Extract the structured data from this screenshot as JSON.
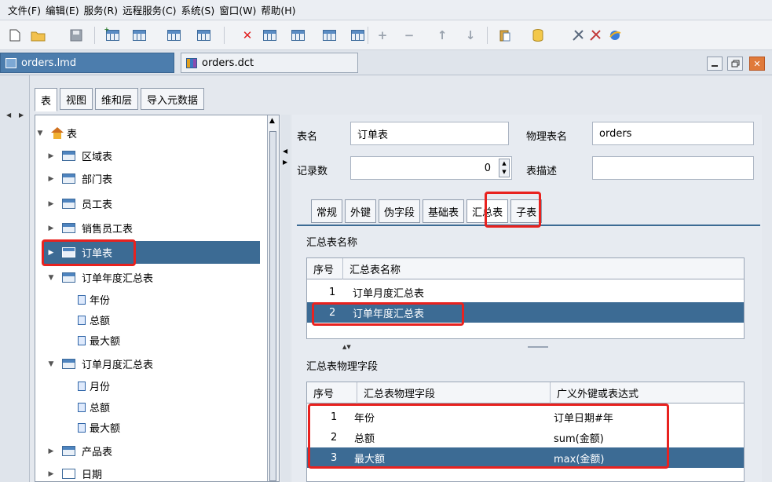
{
  "menu": [
    "文件(F)",
    "编辑(E)",
    "服务(R)",
    "远程服务(C)",
    "系统(S)",
    "窗口(W)",
    "帮助(H)"
  ],
  "documents": {
    "active": "orders.lmd",
    "inactive": "orders.dct"
  },
  "tree_tabs": [
    "表",
    "视图",
    "维和层",
    "导入元数据"
  ],
  "tree": {
    "root": "表",
    "items": [
      {
        "label": "区域表",
        "type": "table",
        "expanded": false
      },
      {
        "label": "部门表",
        "type": "table",
        "expanded": false
      },
      {
        "label": "员工表",
        "type": "table",
        "expanded": false
      },
      {
        "label": "销售员工表",
        "type": "table",
        "expanded": false
      },
      {
        "label": "订单表",
        "type": "table",
        "expanded": false,
        "selected": true
      },
      {
        "label": "订单年度汇总表",
        "type": "table",
        "expanded": true
      },
      {
        "label": "年份",
        "type": "field"
      },
      {
        "label": "总额",
        "type": "field"
      },
      {
        "label": "最大额",
        "type": "field"
      },
      {
        "label": "订单月度汇总表",
        "type": "table",
        "expanded": true
      },
      {
        "label": "月份",
        "type": "field"
      },
      {
        "label": "总额",
        "type": "field"
      },
      {
        "label": "最大额",
        "type": "field"
      },
      {
        "label": "产品表",
        "type": "table",
        "expanded": false
      },
      {
        "label": "日期",
        "type": "table",
        "expanded": false
      }
    ]
  },
  "form": {
    "table_name_label": "表名",
    "table_name_value": "订单表",
    "physical_name_label": "物理表名",
    "physical_name_value": "orders",
    "record_count_label": "记录数",
    "record_count_value": "0",
    "description_label": "表描述",
    "description_value": ""
  },
  "detail_tabs": [
    "常规",
    "外键",
    "伪字段",
    "基础表",
    "汇总表",
    "子表"
  ],
  "detail_active_tab": "汇总表",
  "summary_tables": {
    "title": "汇总表名称",
    "columns": [
      "序号",
      "汇总表名称"
    ],
    "rows": [
      {
        "no": "1",
        "name": "订单月度汇总表",
        "selected": false
      },
      {
        "no": "2",
        "name": "订单年度汇总表",
        "selected": true
      }
    ]
  },
  "summary_fields": {
    "title": "汇总表物理字段",
    "columns": [
      "序号",
      "汇总表物理字段",
      "广义外键或表达式"
    ],
    "rows": [
      {
        "no": "1",
        "field": "年份",
        "expr": "订单日期#年",
        "selected": false
      },
      {
        "no": "2",
        "field": "总额",
        "expr": "sum(金额)",
        "selected": false
      },
      {
        "no": "3",
        "field": "最大额",
        "expr": "max(金额)",
        "selected": true
      }
    ]
  },
  "colors": {
    "selection": "#3c6b94",
    "highlight_box": "#e8221f",
    "active_doc_tab": "#4c7dad"
  }
}
